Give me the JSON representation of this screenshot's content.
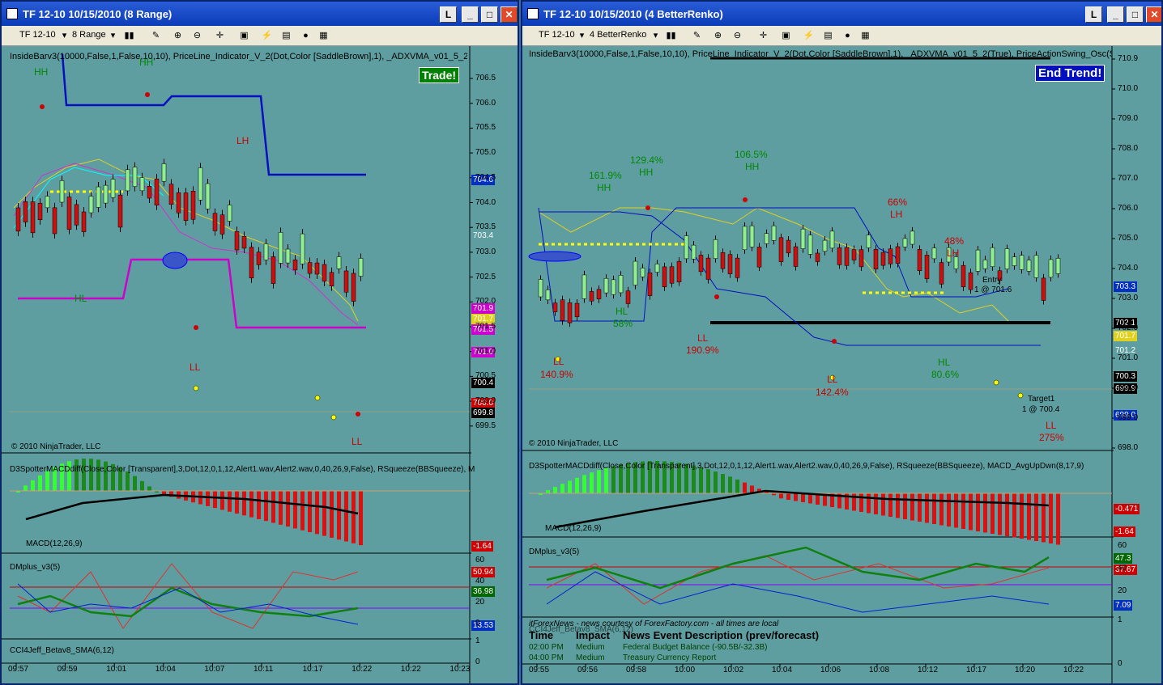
{
  "left": {
    "title": "TF 12-10  10/15/2010 (8 Range)",
    "instrument": "TF 12-10",
    "period": "8 Range",
    "indicators": "InsideBarv3(10000,False,1,False,10,10), PriceLine_Indicator_V_2(Dot,Color [SaddleBrown],1), _ADXVMA_v01_5_2(True), Pric",
    "trade_btn": "Trade!",
    "copyright": "© 2010 NinjaTrader, LLC",
    "macd_params": "D3SpotterMACDdiff(Close,Color [Transparent],3,Dot,12,0,1,12,Alert1.wav,Alert2.wav,0,40,26,9,False), RSqueeze(BBSqueeze), M",
    "macd_label": "MACD(12,26,9)",
    "dm_label": "DMplus_v3(5)",
    "cci_label": "CCI4Jeff_Betav8_SMA(6,12)",
    "yticks": [
      "706.5",
      "706.0",
      "705.5",
      "705.0",
      "704.5",
      "704.0",
      "703.5",
      "703.0",
      "702.5",
      "702.0",
      "701.5",
      "701.0",
      "700.5",
      "700.0",
      "699.5"
    ],
    "price_tags": [
      {
        "v": "704.6",
        "c": "#0030c0"
      },
      {
        "v": "703.4",
        "c": "#5f9ea0"
      },
      {
        "v": "701.9",
        "c": "#cc00cc"
      },
      {
        "v": "701.7",
        "c": "#e0d020"
      },
      {
        "v": "701.5",
        "c": "#cc00cc"
      },
      {
        "v": "701.0",
        "c": "#cc00cc"
      },
      {
        "v": "700.4",
        "c": "#000"
      },
      {
        "v": "700.0",
        "c": "#c00"
      },
      {
        "v": "699.8",
        "c": "#000"
      }
    ],
    "macd_tags": [
      "-1.64"
    ],
    "dm_tags": [
      {
        "v": "50.94",
        "c": "#c00"
      },
      {
        "v": "36.98",
        "c": "#060"
      },
      {
        "v": "13.53",
        "c": "#0030c0"
      }
    ],
    "dm_ticks": [
      "60",
      "40",
      "20",
      "0"
    ],
    "cci_ticks": [
      "1",
      "0"
    ],
    "xticks": [
      "09:57",
      "09:59",
      "10:01",
      "10:04",
      "10:07",
      "10:11",
      "10:17",
      "10:22",
      "10:22",
      "10:23"
    ],
    "annotations": [
      "HH",
      "HH",
      "LH",
      "HL",
      "LL",
      "LL"
    ]
  },
  "right": {
    "title": "TF 12-10  10/15/2010 (4 BetterRenko)",
    "instrument": "TF 12-10",
    "period": "4 BetterRenko",
    "indicators": "InsideBarv3(10000,False,1,False,10,10), PriceLine_Indicator_V_2(Dot,Color [SaddleBrown],1), _ADXVMA_v01_5_2(True), PriceActionSwing_Osc(Standard,4,15",
    "trend_btn": "End Trend!",
    "copyright": "© 2010 NinjaTrader, LLC",
    "macd_params": "D3SpotterMACDdiff(Close,Color [Transparent],3,Dot,12,0,1,12,Alert1.wav,Alert2.wav,0,40,26,9,False), RSqueeze(BBSqueeze), MACD_AvgUpDwn(8,17,9)",
    "macd_label": "MACD(12,26,9)",
    "dm_label": "DMplus_v3(5)",
    "cci_label": "CCI4Jeff_Betav8_SMA(6,12)",
    "yticks": [
      "710.9",
      "710.0",
      "709.0",
      "708.0",
      "707.0",
      "706.0",
      "705.0",
      "704.0",
      "703.0",
      "702.0",
      "701.0",
      "700.0",
      "699.0",
      "698.0"
    ],
    "price_tags": [
      {
        "v": "703.3",
        "c": "#0030c0"
      },
      {
        "v": "702.1",
        "c": "#000"
      },
      {
        "v": "701.7",
        "c": "#e0d020"
      },
      {
        "v": "701.2",
        "c": "#5f9ea0"
      },
      {
        "v": "700.3",
        "c": "#000"
      },
      {
        "v": "699.9",
        "c": "#000"
      },
      {
        "v": "699.0",
        "c": "#0030c0"
      }
    ],
    "macd_tags": [
      "-0.471",
      "-1.64"
    ],
    "dm_tags": [
      {
        "v": "47.3",
        "c": "#060"
      },
      {
        "v": "37.67",
        "c": "#c00"
      },
      {
        "v": "7.09",
        "c": "#0030c0"
      }
    ],
    "dm_ticks": [
      "60",
      "40",
      "20"
    ],
    "cci_ticks": [
      "1",
      "0"
    ],
    "xticks": [
      "09:55",
      "09:56",
      "09:58",
      "10:00",
      "10:02",
      "10:04",
      "10:06",
      "10:08",
      "10:12",
      "10:17",
      "10:20",
      "10:22"
    ],
    "annotations": [
      "161.9%",
      "HH",
      "129.4%",
      "HH",
      "106.5%",
      "HH",
      "66%",
      "LH",
      "48%",
      "LH",
      "HL",
      "58%",
      "LL",
      "190.9%",
      "LL",
      "140.9%",
      "LL",
      "142.4%",
      "HL",
      "80.6%",
      "Entry",
      "1 @ 701.6",
      "Target1",
      "1 @ 700.4",
      "LL",
      "275%"
    ],
    "news_header": "itForexNews - news courtesy of ForexFactory.com - all times are local",
    "news_cols": [
      "Time",
      "Impact",
      "News Event Description (prev/forecast)"
    ],
    "news_rows": [
      {
        "time": "02:00 PM",
        "impact": "Medium",
        "desc": "Federal Budget Balance (-90.5B/-32.3B)"
      },
      {
        "time": "04:00 PM",
        "impact": "Medium",
        "desc": "Treasury Currency Report"
      }
    ]
  }
}
